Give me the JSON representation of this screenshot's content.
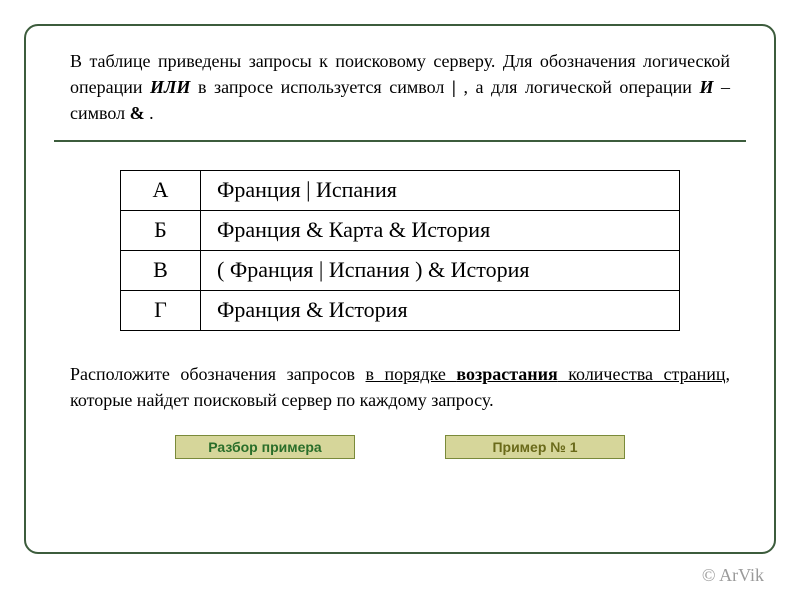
{
  "intro": {
    "text_before_or": "В таблице приведены запросы к поисковому серверу. Для обозначения логической операции ",
    "or_word": "ИЛИ",
    "text_mid": " в запросе используется символ ",
    "pipe": "|",
    "text_and_pre": ", а для логической операции ",
    "and_word": "И",
    "text_sym": " – символ ",
    "amp": "&",
    "period": "."
  },
  "table": {
    "rows": [
      {
        "key": "А",
        "query": "Франция  |  Испания"
      },
      {
        "key": "Б",
        "query": "Франция  &  Карта  &  История"
      },
      {
        "key": "В",
        "query": "( Франция  |  Испания )  &  История"
      },
      {
        "key": "Г",
        "query": "Франция  &  История"
      }
    ]
  },
  "task": {
    "pre": "Расположите обозначения запросов ",
    "u1": "в порядке ",
    "ub": "возрастания",
    "u2": " количества страниц",
    "post": ", которые найдет поисковый сервер по каждому запросу."
  },
  "buttons": {
    "left": "Разбор примера",
    "right": "Пример № 1"
  },
  "copyright": "© ArVik"
}
